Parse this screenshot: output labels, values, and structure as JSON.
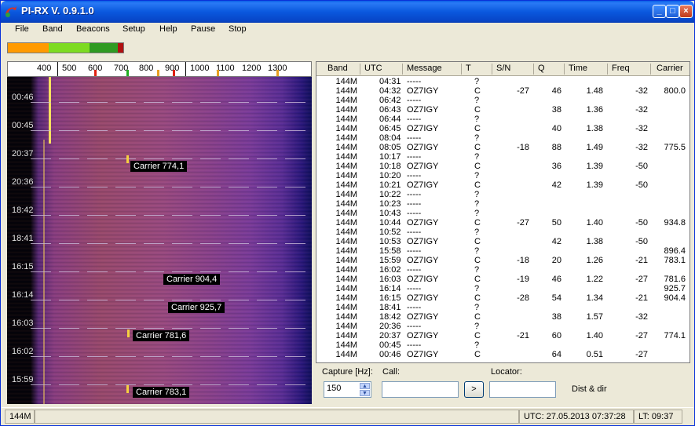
{
  "window": {
    "title": "PI-RX  V.  0.9.1.0"
  },
  "menu": [
    "File",
    "Band",
    "Beacons",
    "Setup",
    "Help",
    "Pause",
    "Stop"
  ],
  "level_meter": {
    "colors": [
      "#ff9a00",
      "#7ddb22",
      "#2f9a22",
      "#b01010"
    ]
  },
  "ruler": {
    "labels": [
      "400",
      "500",
      "600",
      "700",
      "800",
      "900",
      "1000",
      "1100",
      "1200",
      "1300"
    ]
  },
  "waterfall": {
    "time_labels": [
      "00:46",
      "00:45",
      "20:37",
      "20:36",
      "18:42",
      "18:41",
      "16:15",
      "16:14",
      "16:03",
      "16:02",
      "15:59"
    ],
    "carrier_labels": [
      "Carrier 774,1",
      "Carrier 904,4",
      "Carrier 925,7",
      "Carrier 781,6",
      "Carrier 783,1"
    ]
  },
  "table": {
    "headers": [
      "Band",
      "UTC",
      "Message",
      "T",
      "S/N",
      "Q",
      "Time",
      "Freq",
      "Carrier"
    ],
    "rows": [
      [
        "144M",
        "04:31",
        "-----",
        "?",
        "",
        "",
        "",
        "",
        ""
      ],
      [
        "144M",
        "04:32",
        "OZ7IGY",
        "C",
        "-27",
        "46",
        "1.48",
        "-32",
        "800.0"
      ],
      [
        "144M",
        "06:42",
        "-----",
        "?",
        "",
        "",
        "",
        "",
        ""
      ],
      [
        "144M",
        "06:43",
        "OZ7IGY",
        "C",
        "",
        "38",
        "1.36",
        "-32",
        ""
      ],
      [
        "144M",
        "06:44",
        "-----",
        "?",
        "",
        "",
        "",
        "",
        ""
      ],
      [
        "144M",
        "06:45",
        "OZ7IGY",
        "C",
        "",
        "40",
        "1.38",
        "-32",
        ""
      ],
      [
        "144M",
        "08:04",
        "-----",
        "?",
        "",
        "",
        "",
        "",
        ""
      ],
      [
        "144M",
        "08:05",
        "OZ7IGY",
        "C",
        "-18",
        "88",
        "1.49",
        "-32",
        "775.5"
      ],
      [
        "144M",
        "10:17",
        "-----",
        "?",
        "",
        "",
        "",
        "",
        ""
      ],
      [
        "144M",
        "10:18",
        "OZ7IGY",
        "C",
        "",
        "36",
        "1.39",
        "-50",
        ""
      ],
      [
        "144M",
        "10:20",
        "-----",
        "?",
        "",
        "",
        "",
        "",
        ""
      ],
      [
        "144M",
        "10:21",
        "OZ7IGY",
        "C",
        "",
        "42",
        "1.39",
        "-50",
        ""
      ],
      [
        "144M",
        "10:22",
        "-----",
        "?",
        "",
        "",
        "",
        "",
        ""
      ],
      [
        "144M",
        "10:23",
        "-----",
        "?",
        "",
        "",
        "",
        "",
        ""
      ],
      [
        "144M",
        "10:43",
        "-----",
        "?",
        "",
        "",
        "",
        "",
        ""
      ],
      [
        "144M",
        "10:44",
        "OZ7IGY",
        "C",
        "-27",
        "50",
        "1.40",
        "-50",
        "934.8"
      ],
      [
        "144M",
        "10:52",
        "-----",
        "?",
        "",
        "",
        "",
        "",
        ""
      ],
      [
        "144M",
        "10:53",
        "OZ7IGY",
        "C",
        "",
        "42",
        "1.38",
        "-50",
        ""
      ],
      [
        "144M",
        "15:58",
        "-----",
        "?",
        "",
        "",
        "",
        "",
        "896.4"
      ],
      [
        "144M",
        "15:59",
        "OZ7IGY",
        "C",
        "-18",
        "20",
        "1.26",
        "-21",
        "783.1"
      ],
      [
        "144M",
        "16:02",
        "-----",
        "?",
        "",
        "",
        "",
        "",
        ""
      ],
      [
        "144M",
        "16:03",
        "OZ7IGY",
        "C",
        "-19",
        "46",
        "1.22",
        "-27",
        "781.6"
      ],
      [
        "144M",
        "16:14",
        "-----",
        "?",
        "",
        "",
        "",
        "",
        "925.7"
      ],
      [
        "144M",
        "16:15",
        "OZ7IGY",
        "C",
        "-28",
        "54",
        "1.34",
        "-21",
        "904.4"
      ],
      [
        "144M",
        "18:41",
        "-----",
        "?",
        "",
        "",
        "",
        "",
        ""
      ],
      [
        "144M",
        "18:42",
        "OZ7IGY",
        "C",
        "",
        "38",
        "1.57",
        "-32",
        ""
      ],
      [
        "144M",
        "20:36",
        "-----",
        "?",
        "",
        "",
        "",
        "",
        ""
      ],
      [
        "144M",
        "20:37",
        "OZ7IGY",
        "C",
        "-21",
        "60",
        "1.40",
        "-27",
        "774.1"
      ],
      [
        "144M",
        "00:45",
        "-----",
        "?",
        "",
        "",
        "",
        "",
        ""
      ],
      [
        "144M",
        "00:46",
        "OZ7IGY",
        "C",
        "",
        "64",
        "0.51",
        "-27",
        ""
      ]
    ]
  },
  "controls": {
    "capture_label": "Capture [Hz]:",
    "capture_value": "150",
    "call_label": "Call:",
    "call_value": "",
    "go_label": ">",
    "locator_label": "Locator:",
    "locator_value": "",
    "distdir_label": "Dist & dir"
  },
  "status": {
    "band": "144M",
    "utc": "UTC:  27.05.2013  07:37:28",
    "lt": "LT:   09:37"
  }
}
